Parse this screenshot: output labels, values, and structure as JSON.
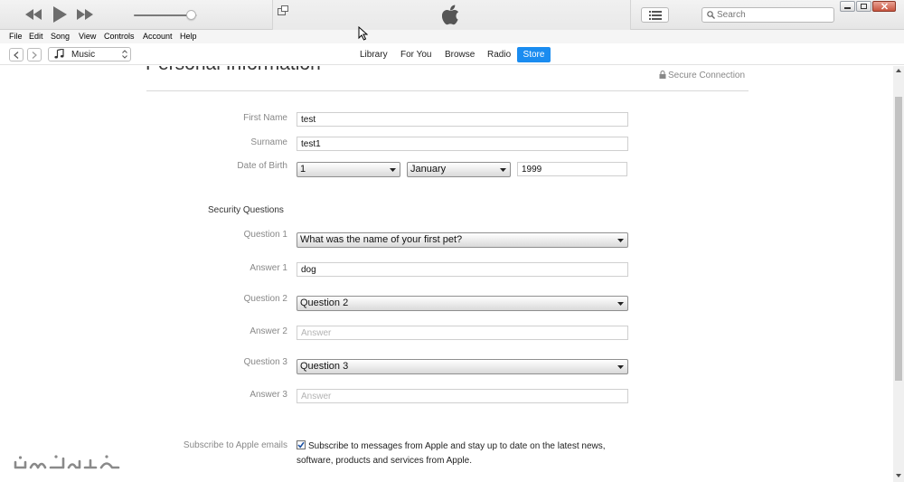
{
  "player": {
    "controls": [
      "rewind-icon",
      "play-icon",
      "fast-forward-icon"
    ],
    "volume_level": 0.9
  },
  "search": {
    "placeholder": "Search"
  },
  "menu": [
    "File",
    "Edit",
    "Song",
    "View",
    "Controls",
    "Account",
    "Help"
  ],
  "media_selector": {
    "label": "Music"
  },
  "tabs": [
    {
      "label": "Library"
    },
    {
      "label": "For You"
    },
    {
      "label": "Browse"
    },
    {
      "label": "Radio"
    },
    {
      "label": "Store",
      "active": true
    }
  ],
  "page": {
    "title": "Personal Information",
    "secure_text": "Secure Connection"
  },
  "form": {
    "first_name": {
      "label": "First Name",
      "value": "test"
    },
    "surname": {
      "label": "Surname",
      "value": "test1"
    },
    "dob": {
      "label": "Date of Birth",
      "day": "1",
      "month": "January",
      "year": "1999"
    },
    "security_heading": "Security Questions",
    "question1": {
      "label": "Question 1",
      "value": "What was the name of your first pet?"
    },
    "answer1": {
      "label": "Answer 1",
      "value": "dog"
    },
    "question2": {
      "label": "Question 2",
      "value": "Question 2"
    },
    "answer2": {
      "label": "Answer 2",
      "value": "",
      "placeholder": "Answer"
    },
    "question3": {
      "label": "Question 3",
      "value": "Question 3"
    },
    "answer3": {
      "label": "Answer 3",
      "value": "",
      "placeholder": "Answer"
    },
    "subscribe": {
      "label": "Subscribe to Apple emails",
      "checked": true,
      "text": "Subscribe to messages from Apple and stay up to date on the latest news, software, products and services from Apple."
    }
  },
  "colors": {
    "accent": "#1a8cf0"
  },
  "watermark": "شبکه هزاره"
}
